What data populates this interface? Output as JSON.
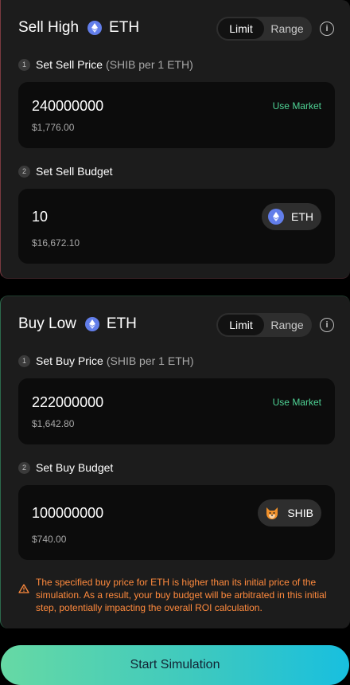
{
  "sell": {
    "title": "Sell High",
    "token": "ETH",
    "toggle": {
      "limit": "Limit",
      "range": "Range",
      "active": "Limit"
    },
    "price_step": {
      "num": "1",
      "label": "Set Sell Price",
      "hint": "(SHIB per 1 ETH)"
    },
    "price": {
      "value": "240000000",
      "usd": "$1,776.00",
      "use_market": "Use Market"
    },
    "budget_step": {
      "num": "2",
      "label": "Set Sell Budget"
    },
    "budget": {
      "value": "10",
      "usd": "$16,672.10",
      "token": "ETH"
    }
  },
  "buy": {
    "title": "Buy Low",
    "token": "ETH",
    "toggle": {
      "limit": "Limit",
      "range": "Range",
      "active": "Limit"
    },
    "price_step": {
      "num": "1",
      "label": "Set Buy Price",
      "hint": "(SHIB per 1 ETH)"
    },
    "price": {
      "value": "222000000",
      "usd": "$1,642.80",
      "use_market": "Use Market"
    },
    "budget_step": {
      "num": "2",
      "label": "Set Buy Budget"
    },
    "budget": {
      "value": "100000000",
      "usd": "$740.00",
      "token": "SHIB"
    },
    "warning": "The specified buy price for ETH is higher than its initial price of the simulation. As a result, your buy budget will be arbitrated in this initial step, potentially impacting the overall ROI calculation."
  },
  "start_button": "Start Simulation",
  "colors": {
    "accent_green": "#4fd395",
    "warning_orange": "#ff8a3d",
    "eth_blue": "#627eea",
    "sell_border": "#7a3a40",
    "buy_border": "#2c6a4c"
  },
  "icons": {
    "eth": "ethereum-icon",
    "shib": "shiba-icon",
    "info": "info-icon",
    "warning": "warning-triangle-icon"
  }
}
